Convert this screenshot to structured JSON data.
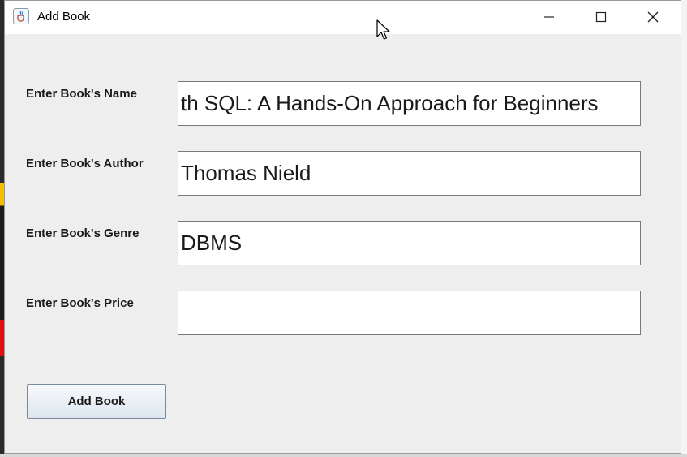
{
  "window": {
    "title": "Add Book"
  },
  "form": {
    "fields": [
      {
        "label": "Enter Book's Name",
        "value": "th SQL: A Hands-On Approach for Beginners",
        "placeholder": ""
      },
      {
        "label": "Enter Book's Author",
        "value": "Thomas Nield",
        "placeholder": ""
      },
      {
        "label": "Enter Book's Genre",
        "value": "DBMS",
        "placeholder": ""
      },
      {
        "label": "Enter Book's Price",
        "value": "",
        "placeholder": ""
      }
    ],
    "submit_label": "Add Book"
  },
  "icons": {
    "app": "java-cup-icon",
    "minimize": "minimize-icon",
    "maximize": "maximize-icon",
    "close": "close-icon",
    "cursor": "mouse-pointer-icon"
  },
  "colors": {
    "window_bg": "#eeeeee",
    "titlebar_bg": "#ffffff",
    "field_bg": "#ffffff",
    "button_gradient_top": "#f7f9fb",
    "button_gradient_bottom": "#dde6ef"
  }
}
